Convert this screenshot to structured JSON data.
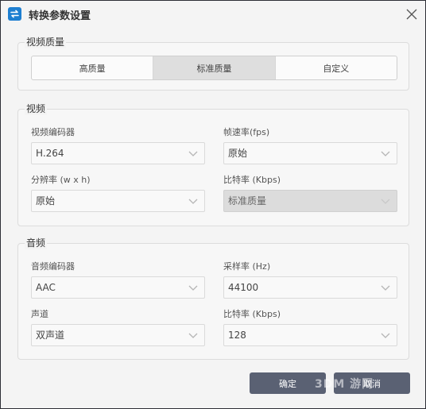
{
  "window": {
    "title": "转换参数设置"
  },
  "quality": {
    "group_label": "视频质量",
    "options": [
      "高质量",
      "标准质量",
      "自定义"
    ],
    "selected": "标准质量"
  },
  "video": {
    "group_label": "视频",
    "encoder": {
      "label": "视频编码器",
      "value": "H.264"
    },
    "fps": {
      "label": "帧速率(fps)",
      "value": "原始"
    },
    "resolution": {
      "label": "分辨率 (w x h)",
      "value": "原始"
    },
    "bitrate": {
      "label": "比特率 (Kbps)",
      "value": "标准质量"
    }
  },
  "audio": {
    "group_label": "音频",
    "encoder": {
      "label": "音频编码器",
      "value": "AAC"
    },
    "samplerate": {
      "label": "采样率 (Hz)",
      "value": "44100"
    },
    "channel": {
      "label": "声道",
      "value": "双声道"
    },
    "bitrate": {
      "label": "比特率 (Kbps)",
      "value": "128"
    }
  },
  "buttons": {
    "ok": "确定",
    "cancel": "取消"
  },
  "watermark": "3DM 游网",
  "colors": {
    "app_icon": "#1e7fd1",
    "button": "#5a6173",
    "active_segment": "#dedede"
  },
  "icons": {
    "app": "convert-arrows-icon",
    "close": "close-icon",
    "dropdown": "chevron-down-icon"
  }
}
